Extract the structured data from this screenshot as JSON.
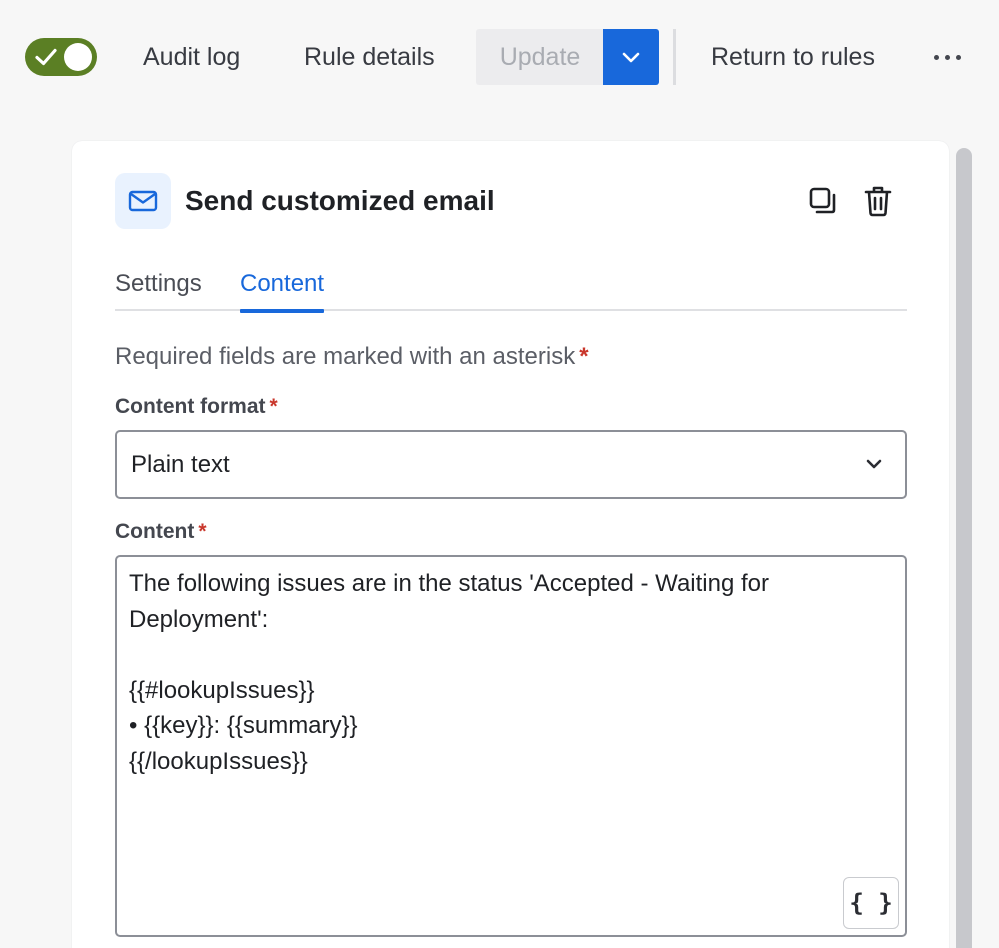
{
  "toolbar": {
    "toggle_state": "on",
    "audit_log_label": "Audit log",
    "rule_details_label": "Rule details",
    "update_label": "Update",
    "return_label": "Return to rules"
  },
  "panel": {
    "title": "Send customized email",
    "tabs": [
      {
        "label": "Settings",
        "active": false
      },
      {
        "label": "Content",
        "active": true
      }
    ],
    "required_note": "Required fields are marked with an asterisk",
    "required_marker": "*",
    "content_format": {
      "label": "Content format",
      "value": "Plain text"
    },
    "content": {
      "label": "Content",
      "value": "The following issues are in the status 'Accepted - Waiting for Deployment':\n\n{{#lookupIssues}}\n• {{key}}: {{summary}}\n{{/lookupIssues}}",
      "smart_values_button": "{ }"
    }
  },
  "icons": {
    "toggle": "check-icon",
    "dropdown": "chevron-down-icon",
    "more": "more-horizontal-icon",
    "action": "mail-icon",
    "duplicate": "duplicate-icon",
    "delete": "trash-icon",
    "smart_values": "braces-icon"
  },
  "colors": {
    "accent": "#1868db",
    "toggle_on": "#5b7f24",
    "required": "#c9372c",
    "action_icon_bg": "#e9f2fe"
  }
}
